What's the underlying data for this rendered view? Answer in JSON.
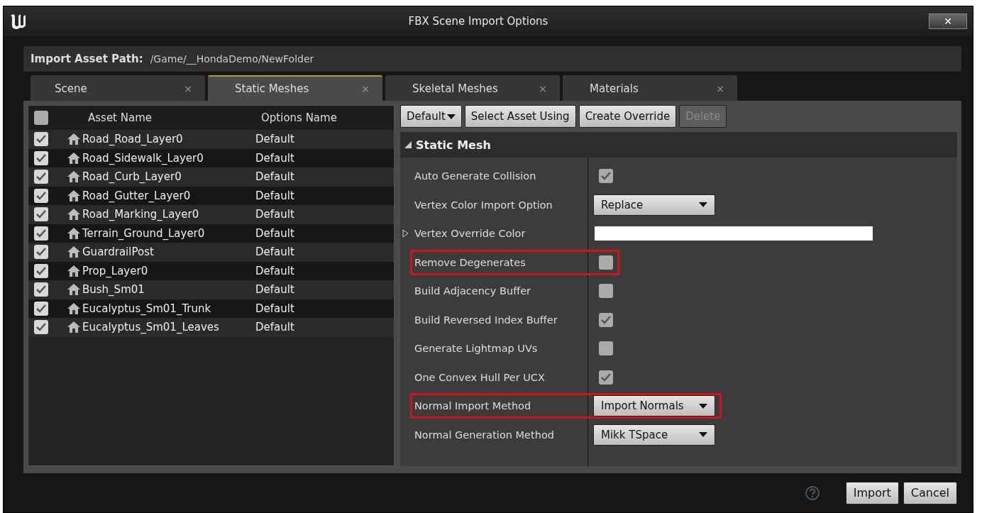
{
  "window": {
    "title": "FBX Scene Import Options",
    "close": "✕"
  },
  "path_bar": {
    "label": "Import Asset Path:",
    "value": "/Game/__HondaDemo/NewFolder"
  },
  "tabs": [
    {
      "label": "Scene",
      "close": "×",
      "selected": false
    },
    {
      "label": "Static Meshes",
      "close": "×",
      "selected": true
    },
    {
      "label": "Skeletal Meshes",
      "close": "×",
      "selected": false
    },
    {
      "label": "Materials",
      "close": "×",
      "selected": false
    }
  ],
  "asset_table": {
    "header_checked": false,
    "columns": [
      "Asset Name",
      "Options Name"
    ],
    "rows": [
      {
        "name": "Road_Road_Layer0",
        "options": "Default",
        "checked": true
      },
      {
        "name": "Road_Sidewalk_Layer0",
        "options": "Default",
        "checked": true
      },
      {
        "name": "Road_Curb_Layer0",
        "options": "Default",
        "checked": true
      },
      {
        "name": "Road_Gutter_Layer0",
        "options": "Default",
        "checked": true
      },
      {
        "name": "Road_Marking_Layer0",
        "options": "Default",
        "checked": true
      },
      {
        "name": "Terrain_Ground_Layer0",
        "options": "Default",
        "checked": true
      },
      {
        "name": "GuardrailPost",
        "options": "Default",
        "checked": true
      },
      {
        "name": "Prop_Layer0",
        "options": "Default",
        "checked": true
      },
      {
        "name": "Bush_Sm01",
        "options": "Default",
        "checked": true
      },
      {
        "name": "Eucalyptus_Sm01_Trunk",
        "options": "Default",
        "checked": true
      },
      {
        "name": "Eucalyptus_Sm01_Leaves",
        "options": "Default",
        "checked": true
      }
    ]
  },
  "toolbar": [
    {
      "label": "Default",
      "kind": "dropdown",
      "disabled": false
    },
    {
      "label": "Select Asset Using",
      "kind": "button",
      "disabled": false
    },
    {
      "label": "Create Override",
      "kind": "button",
      "disabled": false
    },
    {
      "label": "Delete",
      "kind": "button",
      "disabled": true
    }
  ],
  "section": {
    "title": "Static Mesh",
    "expanded": true,
    "properties": [
      {
        "label": "Auto Generate Collision",
        "kind": "checkbox",
        "checked": true,
        "highlighted": false
      },
      {
        "label": "Vertex Color Import Option",
        "kind": "dropdown",
        "value": "Replace",
        "highlighted": false
      },
      {
        "label": "Vertex Override Color",
        "kind": "color",
        "color": "#ffffff",
        "expanded": false,
        "highlighted": false
      },
      {
        "label": "Remove Degenerates",
        "kind": "checkbox",
        "checked": false,
        "highlighted": true
      },
      {
        "label": "Build Adjacency Buffer",
        "kind": "checkbox",
        "checked": false,
        "highlighted": false
      },
      {
        "label": "Build Reversed Index Buffer",
        "kind": "checkbox",
        "checked": true,
        "highlighted": false
      },
      {
        "label": "Generate Lightmap UVs",
        "kind": "checkbox",
        "checked": false,
        "highlighted": false
      },
      {
        "label": "One Convex Hull Per UCX",
        "kind": "checkbox",
        "checked": true,
        "highlighted": false
      },
      {
        "label": "Normal Import Method",
        "kind": "dropdown",
        "value": "Import Normals",
        "highlighted": true
      },
      {
        "label": "Normal Generation Method",
        "kind": "dropdown",
        "value": "Mikk TSpace",
        "highlighted": false
      }
    ]
  },
  "footer_buttons": [
    "Import",
    "Cancel"
  ]
}
